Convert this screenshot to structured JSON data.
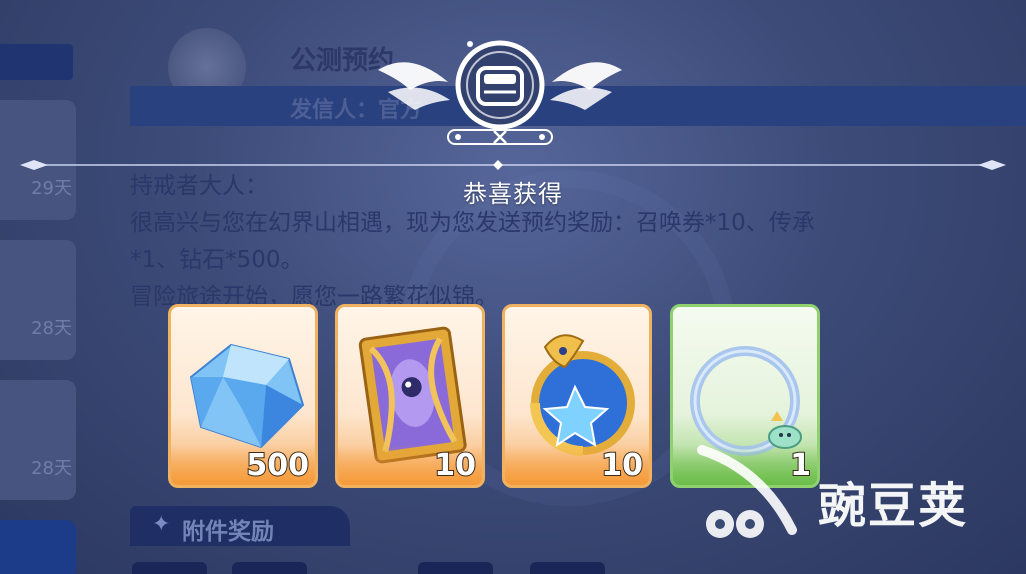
{
  "mail": {
    "title": "公测预约",
    "sender": "发信人：官方",
    "body_lines": [
      "持戒者大人：",
      "很高兴与您在幻界山相遇，现为您发送预约奖励：召唤券*10、传承",
      "*1、钻石*500。",
      "冒险旅途开始，愿您一路繁花似锦。"
    ],
    "attachments_label": "附件奖励"
  },
  "left_list": {
    "days": [
      "29天",
      "28天",
      "28天"
    ]
  },
  "popup": {
    "title": "恭喜获得"
  },
  "rewards": [
    {
      "name": "diamond",
      "count": "500",
      "frame": "orange"
    },
    {
      "name": "summon-card",
      "count": "10",
      "frame": "orange"
    },
    {
      "name": "dragon-star-badge",
      "count": "10",
      "frame": "orange"
    },
    {
      "name": "ring-avatar-frame",
      "count": "1",
      "frame": "green"
    }
  ],
  "watermark": {
    "text": "豌豆荚"
  },
  "colors": {
    "orange_frame": "#f0b160",
    "green_frame": "#8fd16f",
    "backdrop": "#3b4a73"
  }
}
